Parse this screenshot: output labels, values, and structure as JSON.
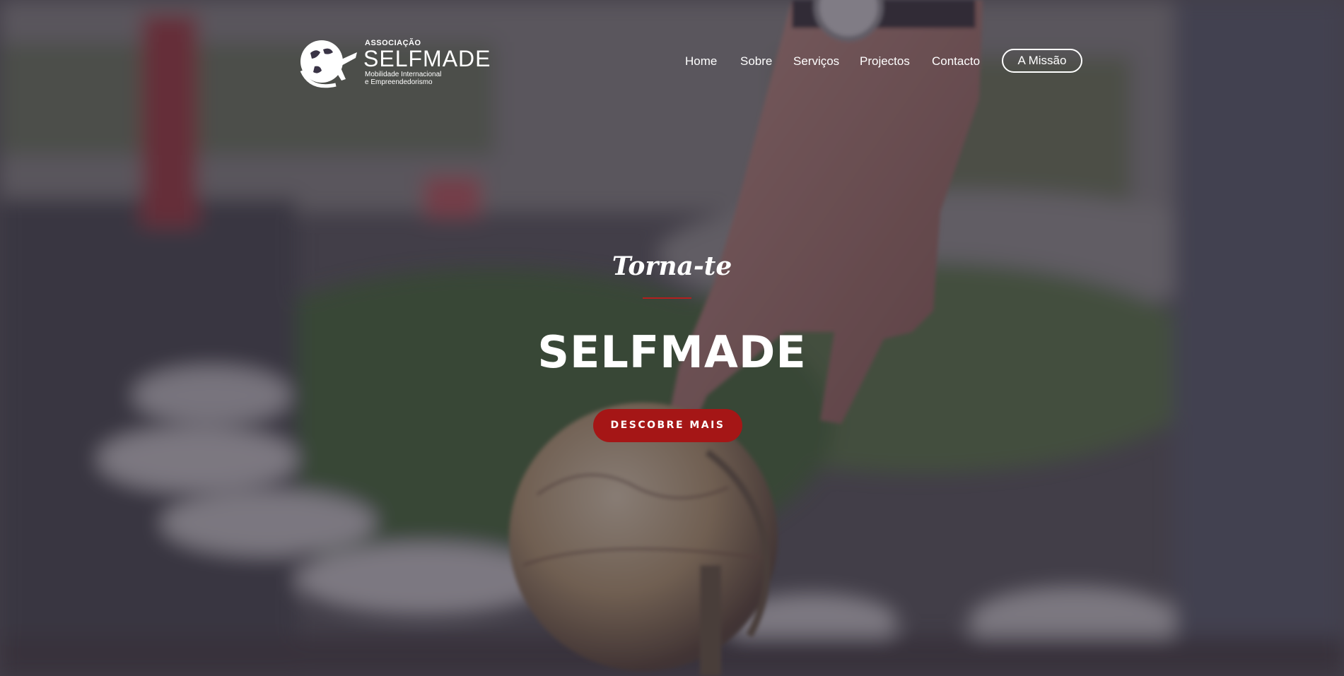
{
  "header": {
    "logo": {
      "small_text": "ASSOCIAÇÃO",
      "big_text": "SELFMADE",
      "tagline_line1": "Mobilidade Internacional",
      "tagline_line2": "e Empreendedorismo"
    },
    "nav": {
      "home": "Home",
      "sobre": "Sobre",
      "servicos": "Serviços",
      "projectos": "Projectos",
      "contacto": "Contacto",
      "missao": "A Missão"
    }
  },
  "hero": {
    "pre_title": "Torna-te",
    "title": "SELFMADE",
    "cta_label": "DESCOBRE MAIS"
  },
  "colors": {
    "accent": "#a51616",
    "text": "#ffffff"
  }
}
